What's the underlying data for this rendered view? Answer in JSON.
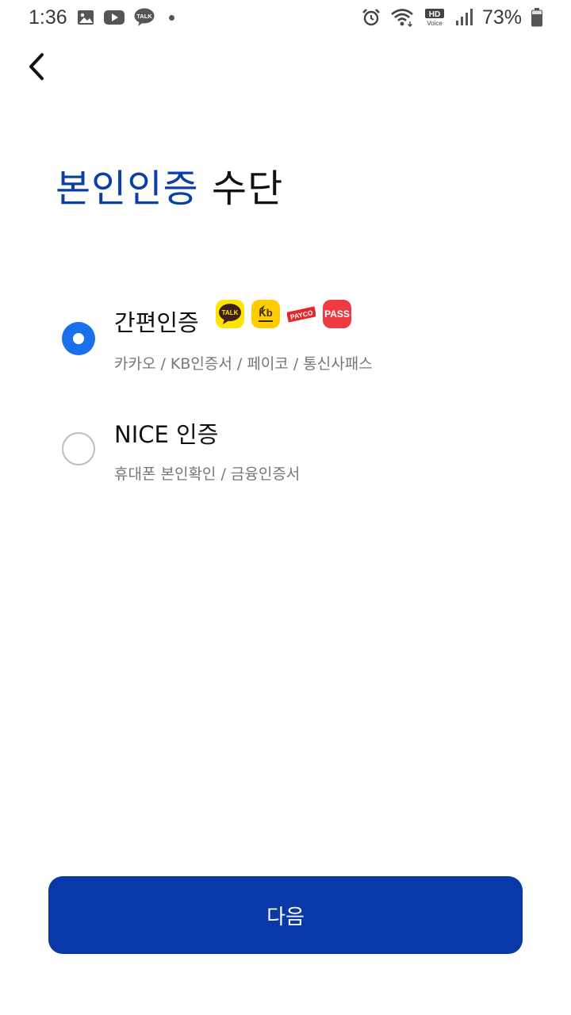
{
  "status_bar": {
    "time": "1:36",
    "battery": "73%",
    "hd_label": "HD",
    "voice_label": "Voice",
    "talk_label": "TALK",
    "icons": [
      "gallery-icon",
      "youtube-icon",
      "kakaotalk-icon",
      "notification-dot-icon",
      "alarm-icon",
      "wifi-icon",
      "hd-voice-icon",
      "signal-icon",
      "battery-icon"
    ]
  },
  "header": {
    "back_icon": "chevron-left-icon"
  },
  "title": {
    "accent": "본인인증",
    "rest": "수단"
  },
  "options": [
    {
      "label": "간편인증",
      "description": "카카오 / KB인증서 / 페이코 / 통신사패스",
      "selected": true,
      "providers": [
        {
          "name": "kakao-icon",
          "text": "TALK",
          "color": "#fee500"
        },
        {
          "name": "kb-icon",
          "text": "Kb",
          "color": "#ffcc00"
        },
        {
          "name": "payco-icon",
          "text": "PAYCO",
          "color": "#e5272d"
        },
        {
          "name": "pass-icon",
          "text": "PASS",
          "color": "#ee3a43"
        }
      ]
    },
    {
      "label": "NICE 인증",
      "description": "휴대폰 본인확인 / 금융인증서",
      "selected": false
    }
  ],
  "next_button": {
    "label": "다음"
  },
  "colors": {
    "accent": "#0a3ea8",
    "button": "#0939a9",
    "radio_selected": "#1a6fea"
  }
}
